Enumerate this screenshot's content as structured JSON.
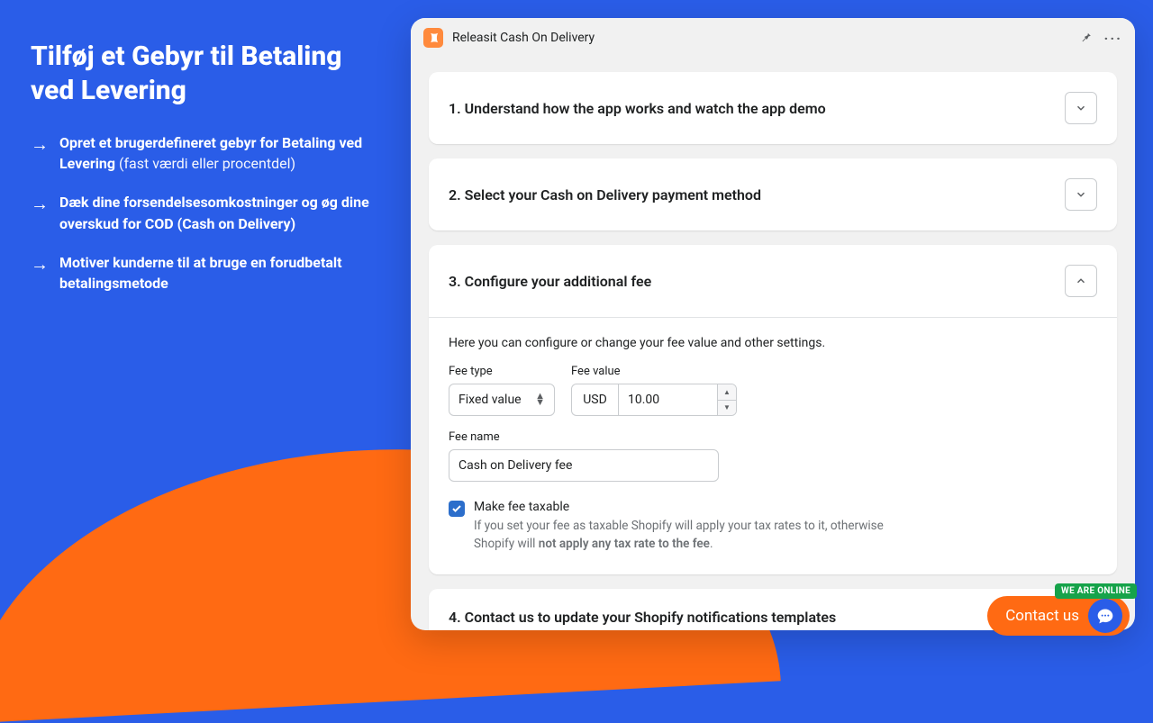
{
  "left": {
    "headline": "Tilføj et Gebyr til Betaling ved Levering",
    "bullets": [
      {
        "strong": "Opret et brugerdefineret gebyr for Betaling ved Levering",
        "rest": " (fast værdi eller procentdel)"
      },
      {
        "strong": "Dæk dine forsendelsesomkostninger og øg dine overskud for COD (Cash on Delivery)",
        "rest": ""
      },
      {
        "strong": "Motiver kunderne til at bruge en forudbetalt betalingsmetode",
        "rest": ""
      }
    ]
  },
  "app": {
    "title": "Releasit Cash On Delivery",
    "panels": {
      "one": "1. Understand how the app works and watch the app demo",
      "two": "2. Select your Cash on Delivery payment method",
      "three": "3. Configure your additional fee",
      "four": "4. Contact us to update your Shopify notifications templates"
    },
    "p3": {
      "desc": "Here you can configure or change your fee value and other settings.",
      "feeTypeLabel": "Fee type",
      "feeTypeValue": "Fixed value",
      "feeValueLabel": "Fee value",
      "currency": "USD",
      "amount": "10.00",
      "feeNameLabel": "Fee name",
      "feeNameValue": "Cash on Delivery fee",
      "taxLabel": "Make fee taxable",
      "taxDesc1": "If you set your fee as taxable Shopify will apply your tax rates to it, otherwise Shopify will ",
      "taxDesc2": "not apply any tax rate to the fee",
      "taxDesc3": "."
    }
  },
  "contact": {
    "label": "Contact us",
    "online": "WE ARE ONLINE"
  }
}
